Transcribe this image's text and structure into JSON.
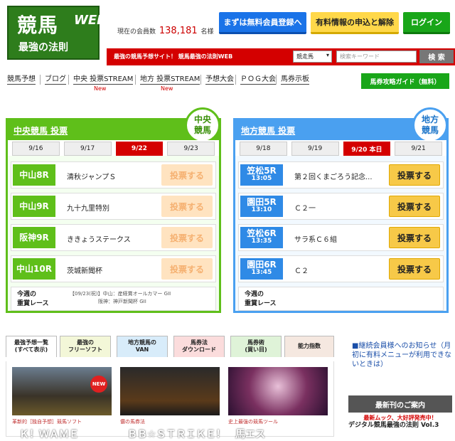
{
  "header": {
    "logo_main": "競馬",
    "logo_sub": "最強の法則",
    "logo_web": "WEB",
    "members_label": "現在の会員数",
    "members_count": "138,181",
    "members_unit": "名様",
    "btn_register": "まずは無料会員登録へ",
    "btn_paid": "有料情報の申込と解除",
    "btn_login": "ログイン",
    "tagline": "最強の競馬予想サイト！ 競馬最強の法則WEB",
    "search_select": "競走馬",
    "search_placeholder": "検索キーワード",
    "search_button": "検 索"
  },
  "nav": {
    "items": [
      "競馬予想",
      "ブログ",
      "中央 投票STREAM",
      "地方 投票STREAM",
      "予想大会",
      "ＰＯＧ大会",
      "馬券示板"
    ],
    "new_label": "New",
    "guide_button": "馬券攻略ガイド（無料）"
  },
  "central": {
    "title": "中央競馬 投票",
    "badge": [
      "中央",
      "競馬"
    ],
    "dates": [
      "9/16",
      "9/17",
      "9/22",
      "9/23"
    ],
    "active_date": 2,
    "races": [
      {
        "label": "中山8R",
        "name": "清秋ジャンプＳ",
        "button": "投票する"
      },
      {
        "label": "中山9R",
        "name": "九十九里特別",
        "button": "投票する"
      },
      {
        "label": "阪神9R",
        "name": "ききょうステークス",
        "button": "投票する"
      },
      {
        "label": "中山10R",
        "name": "茨城新聞杯",
        "button": "投票する"
      }
    ],
    "weekly_label": [
      "今週の",
      "重賞レース"
    ],
    "weekly_lines": [
      "【09/23(祝)】中山：産経賞オールカマー GII",
      "阪神：神戸新聞杯 GII"
    ]
  },
  "local": {
    "title": "地方競馬 投票",
    "badge": [
      "地方",
      "競馬"
    ],
    "dates": [
      "9/18",
      "9/19",
      "9/20 本日",
      "9/21"
    ],
    "active_date": 2,
    "races": [
      {
        "label": "笠松5R",
        "time": "13:05",
        "name": "第２回くまごろう記念...",
        "button": "投票する"
      },
      {
        "label": "園田5R",
        "time": "13:10",
        "name": "Ｃ２一",
        "button": "投票する"
      },
      {
        "label": "笠松6R",
        "time": "13:35",
        "name": "サラ系Ｃ６組",
        "button": "投票する"
      },
      {
        "label": "園田6R",
        "time": "13:45",
        "name": "Ｃ２",
        "button": "投票する"
      }
    ],
    "weekly_label": [
      "今週の",
      "重賞レース"
    ]
  },
  "tabs": [
    {
      "label": [
        "最強予想一覧",
        "(すべて表示)"
      ],
      "color": "#ffffff"
    },
    {
      "label": [
        "最強の",
        "フリーソフト"
      ],
      "color": "#f3f7d8"
    },
    {
      "label": [
        "地方競馬の",
        "VAN"
      ],
      "color": "#d8ecfa"
    },
    {
      "label": [
        "馬券法",
        "ダウンロード"
      ],
      "color": "#fbdcdc"
    },
    {
      "label": [
        "馬券術",
        "(買い目)"
      ],
      "color": "#dff3d8"
    },
    {
      "label": [
        "能力指数"
      ],
      "color": "#f5e8e0"
    }
  ],
  "cards": [
    {
      "category": "革新的［独自予想］競馬ソフト",
      "title": "Ｋ！ＷＡＭＥ",
      "badge": "NEW"
    },
    {
      "category": "儂の馬券法",
      "title": "ＢＢ☆ＳＴＲＩＫＥ！"
    },
    {
      "category": "史上最強の競馬ツール",
      "title": "馬エス"
    }
  ],
  "sidebar": {
    "notice": "■継続会員様へのお知らせ（月初に有料メニューが利用できないときは）",
    "new_book_header": "最新刊のご案内",
    "new_book_teaser": "最新ムック、大好評発売中！",
    "new_book_title": "デジタル競馬最強の法則 Vol.3"
  }
}
